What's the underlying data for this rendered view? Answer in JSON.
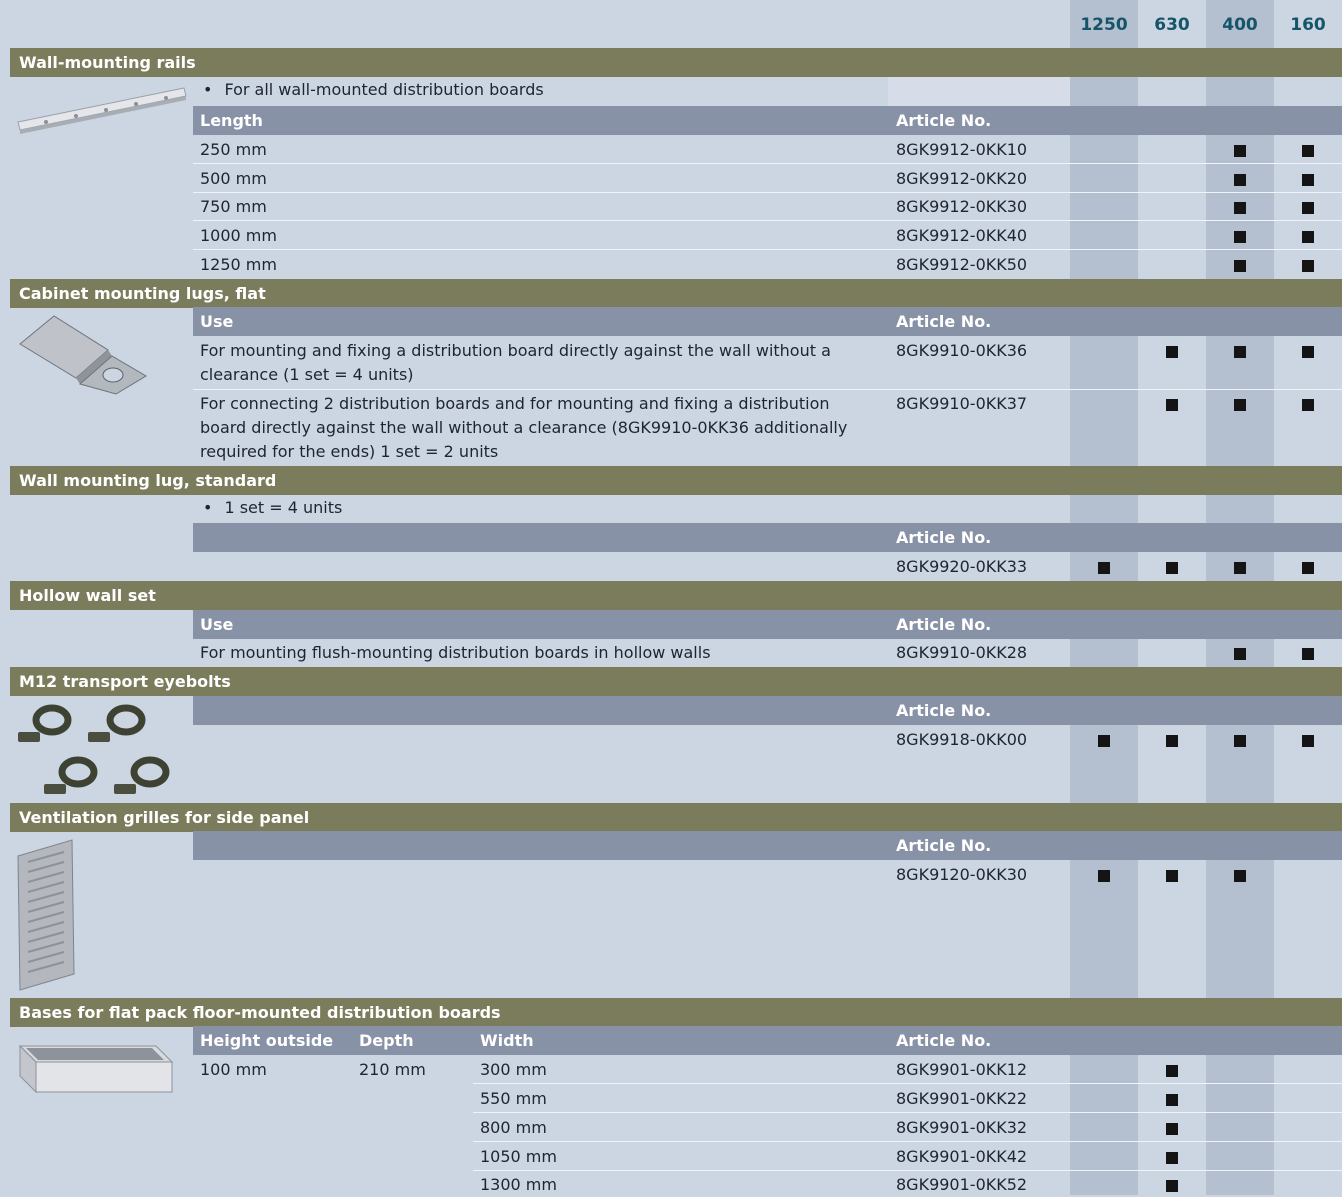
{
  "columns": [
    "1250",
    "630",
    "400",
    "160"
  ],
  "sections": {
    "wall_rails": {
      "title": "Wall-mounting rails",
      "bullet": "For all wall-mounted distribution boards",
      "head_left": "Length",
      "head_article": "Article No.",
      "rows": [
        {
          "c1": "250 mm",
          "art": "8GK9912-0KK10"
        },
        {
          "c1": "500 mm",
          "art": "8GK9912-0KK20"
        },
        {
          "c1": "750 mm",
          "art": "8GK9912-0KK30"
        },
        {
          "c1": "1000 mm",
          "art": "8GK9912-0KK40"
        },
        {
          "c1": "1250 mm",
          "art": "8GK9912-0KK50"
        }
      ]
    },
    "cabinet_lugs": {
      "title": "Cabinet mounting lugs, flat",
      "head_left": "Use",
      "head_article": "Article No.",
      "rows": [
        {
          "c1": "For mounting and fixing a distribution board directly against the wall without a clearance (1 set = 4 units)",
          "art": "8GK9910-0KK36"
        },
        {
          "c1": "For connecting 2 distribution boards and for mounting and fixing a distribution board directly against the wall without a clearance (8GK9910-0KK36 additionally required for the ends) 1 set = 2 units",
          "art": "8GK9910-0KK37"
        }
      ]
    },
    "wall_lug": {
      "title": "Wall mounting lug, standard",
      "bullet": "1 set = 4 units",
      "head_article": "Article No.",
      "rows": [
        {
          "art": "8GK9920-0KK33"
        }
      ]
    },
    "hollow_wall": {
      "title": "Hollow wall set",
      "head_left": "Use",
      "head_article": "Article No.",
      "rows": [
        {
          "c1": "For mounting flush-mounting distribution boards in hollow walls",
          "art": "8GK9910-0KK28"
        }
      ]
    },
    "eyebolts": {
      "title": "M12 transport eyebolts",
      "head_article": "Article No.",
      "rows": [
        {
          "art": "8GK9918-0KK00"
        }
      ]
    },
    "grilles": {
      "title": "Ventilation grilles for side panel",
      "head_article": "Article No.",
      "rows": [
        {
          "art": "8GK9120-0KK30"
        }
      ]
    },
    "bases": {
      "title": "Bases for flat pack floor-mounted distribution boards",
      "head_height": "Height outside",
      "head_depth": "Depth",
      "head_width": "Width",
      "head_article": "Article No.",
      "height_value": "100 mm",
      "depth_value": "210 mm",
      "rows": [
        {
          "c1": "300 mm",
          "art": "8GK9901-0KK12"
        },
        {
          "c1": "550 mm",
          "art": "8GK9901-0KK22"
        },
        {
          "c1": "800 mm",
          "art": "8GK9901-0KK32"
        },
        {
          "c1": "1050 mm",
          "art": "8GK9901-0KK42"
        },
        {
          "c1": "1300 mm",
          "art": "8GK9901-0KK52"
        }
      ]
    }
  },
  "colors": {
    "section_bar": "#7b7c5c",
    "subheader_bar": "#8892a7",
    "background": "#ccd5e2",
    "column_shade": "#b4bfcf",
    "header_text": "#16546a"
  }
}
